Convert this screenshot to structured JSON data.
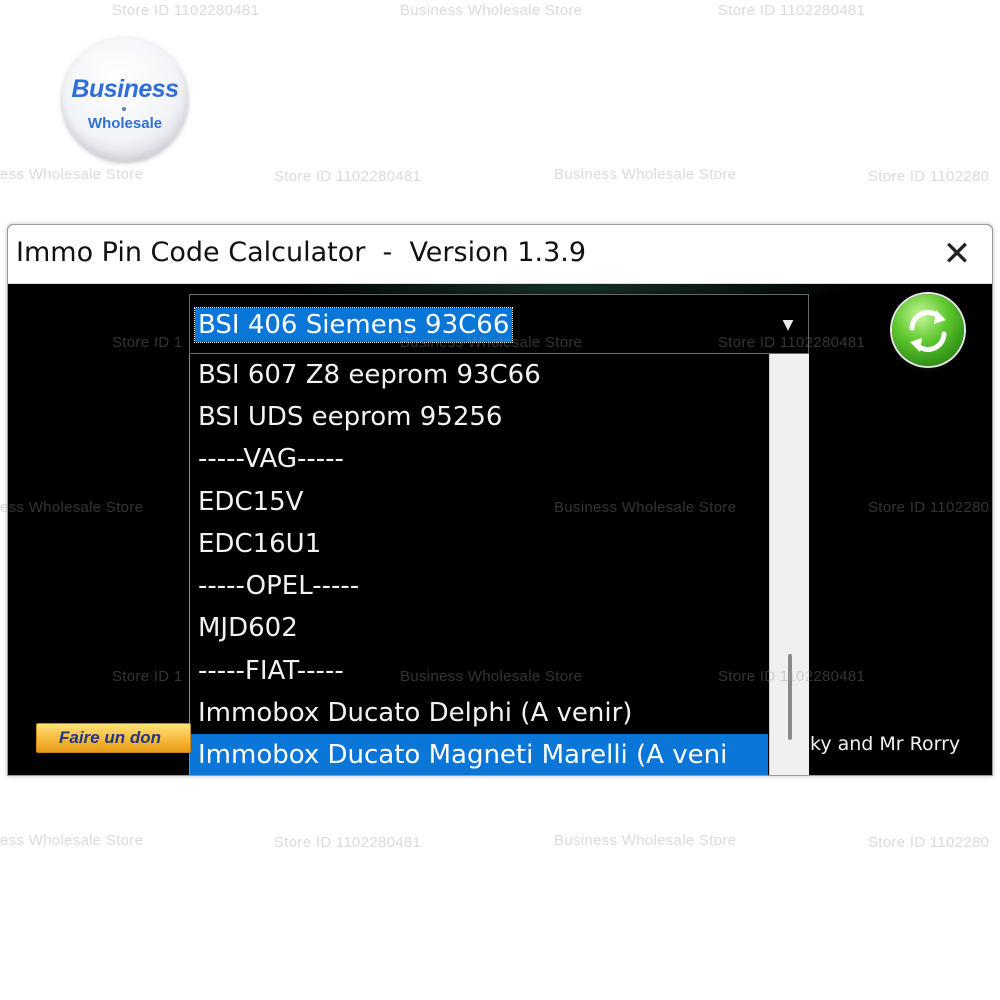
{
  "logo": {
    "title": "Business",
    "subtitle": "Wholesale"
  },
  "watermarks": {
    "store_id": "Store ID 1102280481",
    "store_name": "Business Wholesale Store",
    "store_name_partial": "ess Wholesale Store",
    "store_id_partial_right": "Store ID 1102280",
    "store_id_partial_left": "Store ID 1"
  },
  "window": {
    "title": "Immo Pin Code Calculator  -  Version 1.3.9",
    "close_label": "✕"
  },
  "combo": {
    "selected": "BSI 406 Siemens 93C66",
    "arrow_icon": "chevron-down-icon",
    "options": [
      "BSI 607 Z8 eeprom 93C66",
      "BSI UDS eeprom 95256",
      "-----VAG-----",
      "EDC15V",
      "EDC16U1",
      "-----OPEL-----",
      "MJD602",
      "-----FIAT-----",
      "Immobox Ducato Delphi (A venir)",
      "Immobox Ducato  Magneti Marelli (A veni"
    ],
    "highlighted_index": 9
  },
  "refresh_icon": "refresh-icon",
  "donate_label": "Faire un don",
  "credits": "ky and Mr Rorry",
  "colors": {
    "selection": "#0a76d8",
    "background": "#000000",
    "refresh_green": "#5fc82f",
    "donate_orange": "#f6b93b"
  }
}
